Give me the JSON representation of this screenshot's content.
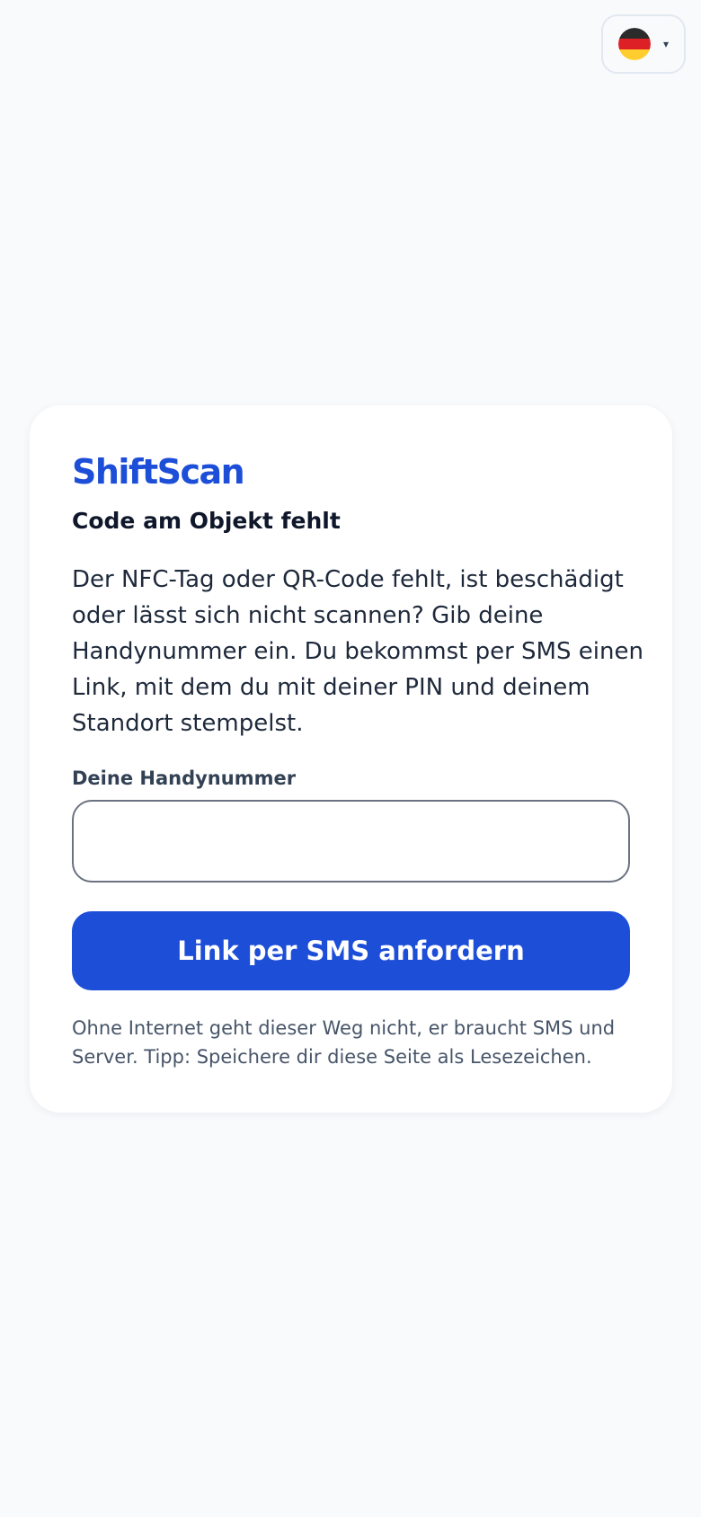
{
  "language_switcher": {
    "flag_icon": "flag-de-icon",
    "flag_colors": [
      "#000000",
      "#dd0000",
      "#ffce00"
    ],
    "caret": "▾"
  },
  "card": {
    "brand": "ShiftScan",
    "title": "Code am Objekt fehlt",
    "description": "Der NFC-Tag oder QR-Code fehlt, ist beschädigt oder lässt sich nicht scannen? Gib deine Handynummer ein. Du bekommst per SMS einen Link, mit dem du mit deiner PIN und deinem Standort stempelst.",
    "phone_label": "Deine Handynummer",
    "phone_value": "",
    "submit_label": "Link per SMS anfordern",
    "note": "Ohne Internet geht dieser Weg nicht, er braucht SMS und Server. Tipp: Speichere dir diese Seite als Lesezeichen."
  },
  "colors": {
    "accent": "#1d4ed8",
    "background": "#f8fafc",
    "card": "#ffffff"
  }
}
